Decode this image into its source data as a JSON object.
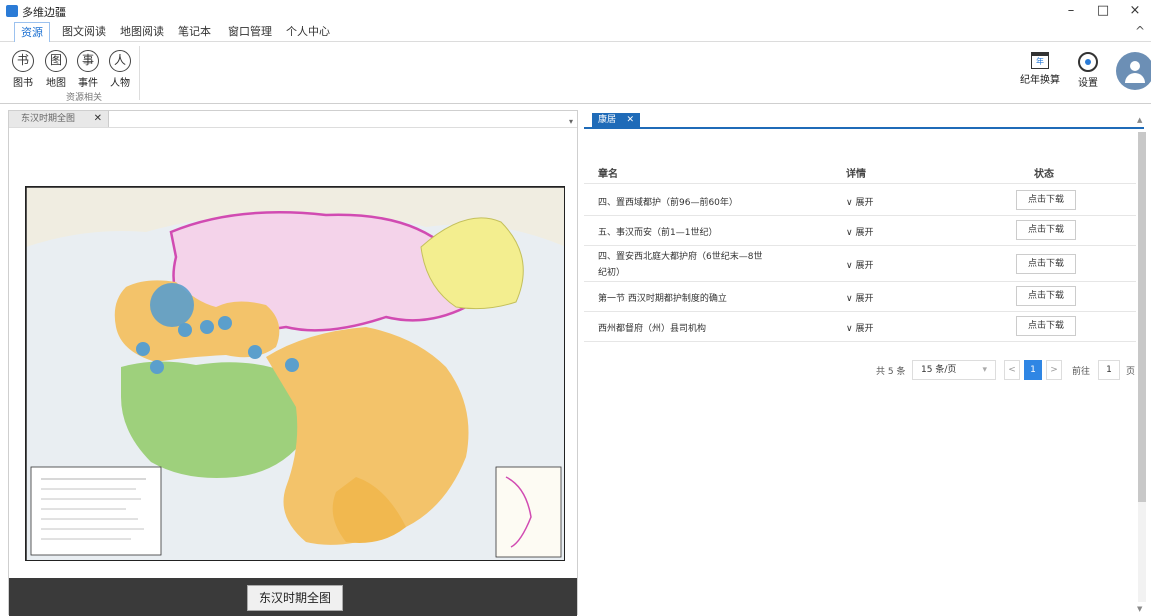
{
  "window": {
    "title": "多维边疆",
    "minimize": "–",
    "maximize": "□",
    "close": "×"
  },
  "menubar": {
    "tabs": [
      "资源",
      "图文阅读",
      "地图阅读",
      "笔记本",
      "窗口管理",
      "个人中心"
    ],
    "collapse": "^"
  },
  "ribbon": {
    "buttons": [
      {
        "glyph": "书",
        "label": "图书"
      },
      {
        "glyph": "图",
        "label": "地图"
      },
      {
        "glyph": "事",
        "label": "事件"
      },
      {
        "glyph": "人",
        "label": "人物"
      }
    ],
    "group_label": "资源相关",
    "calendar_label": "纪年换算",
    "calendar_glyph": "年",
    "settings_label": "设置"
  },
  "left_panel": {
    "tab_label": "东汉时期全图",
    "tab_close": "✕",
    "footer_button": "东汉时期全图"
  },
  "right_panel": {
    "tab_label": "康居",
    "tab_close": "✕",
    "columns": [
      "章名",
      "详情",
      "状态"
    ],
    "rows": [
      {
        "name": "四、置西域都护（前96—前60年）",
        "detail": "∨ 展开",
        "action": "点击下载"
      },
      {
        "name": "五、事汉而安（前1—1世纪）",
        "detail": "∨ 展开",
        "action": "点击下载"
      },
      {
        "name": "四、置安西北庭大都护府（6世纪末—8世纪初）",
        "detail": "∨ 展开",
        "action": "点击下载"
      },
      {
        "name": "第一节 西汉时期都护制度的确立",
        "detail": "∨ 展开",
        "action": "点击下载"
      },
      {
        "name": "西州都督府（州）县司机构",
        "detail": "∨ 展开",
        "action": "点击下载"
      }
    ],
    "pagination": {
      "total": "共 5 条",
      "page_size": "15 条/页",
      "current": "1",
      "goto_label": "前往",
      "goto_value": "1",
      "page_suffix": "页",
      "prev": "<",
      "next": ">"
    }
  }
}
